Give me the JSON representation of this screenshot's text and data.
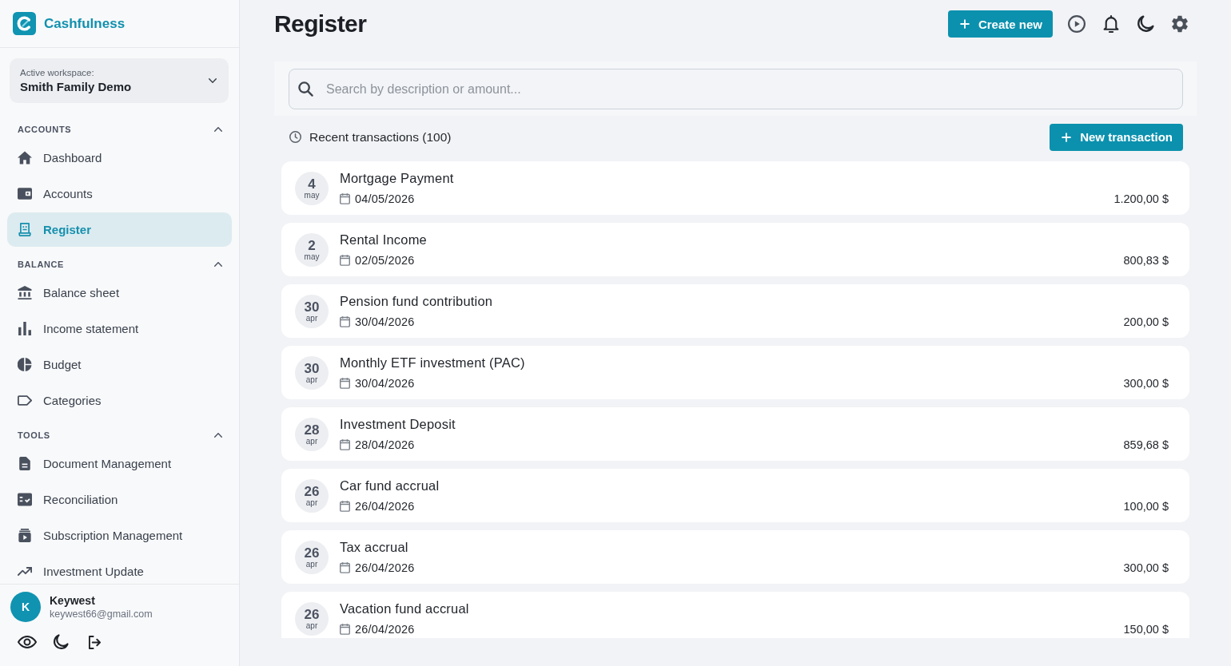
{
  "app": {
    "name": "Cashfulness"
  },
  "workspace": {
    "label": "Active workspace:",
    "value": "Smith Family Demo"
  },
  "sidebar": {
    "sections": [
      {
        "title": "ACCOUNTS",
        "expanded": true,
        "items": [
          {
            "label": "Dashboard",
            "selected": false
          },
          {
            "label": "Accounts",
            "selected": false
          },
          {
            "label": "Register",
            "selected": true
          }
        ]
      },
      {
        "title": "BALANCE",
        "expanded": true,
        "items": [
          {
            "label": "Balance sheet",
            "selected": false
          },
          {
            "label": "Income statement",
            "selected": false
          },
          {
            "label": "Budget",
            "selected": false
          },
          {
            "label": "Categories",
            "selected": false
          }
        ]
      },
      {
        "title": "TOOLS",
        "expanded": true,
        "items": [
          {
            "label": "Document Management",
            "selected": false
          },
          {
            "label": "Reconciliation",
            "selected": false
          },
          {
            "label": "Subscription Management",
            "selected": false
          },
          {
            "label": "Investment Update",
            "selected": false
          }
        ]
      }
    ]
  },
  "user": {
    "initial": "K",
    "name": "Keywest",
    "email": "keywest66@gmail.com"
  },
  "page": {
    "title": "Register",
    "create_button": "Create new"
  },
  "search": {
    "placeholder": "Search by description or amount..."
  },
  "recent": {
    "label": "Recent transactions (100)",
    "button": "New transaction"
  },
  "transactions": [
    {
      "day": "4",
      "month": "may",
      "title": "Mortgage Payment",
      "date": "04/05/2026",
      "amount": "1.200,00 $"
    },
    {
      "day": "2",
      "month": "may",
      "title": "Rental Income",
      "date": "02/05/2026",
      "amount": "800,83 $"
    },
    {
      "day": "30",
      "month": "apr",
      "title": "Pension fund contribution",
      "date": "30/04/2026",
      "amount": "200,00 $"
    },
    {
      "day": "30",
      "month": "apr",
      "title": "Monthly ETF investment (PAC)",
      "date": "30/04/2026",
      "amount": "300,00 $"
    },
    {
      "day": "28",
      "month": "apr",
      "title": "Investment Deposit",
      "date": "28/04/2026",
      "amount": "859,68 $"
    },
    {
      "day": "26",
      "month": "apr",
      "title": "Car fund accrual",
      "date": "26/04/2026",
      "amount": "100,00 $"
    },
    {
      "day": "26",
      "month": "apr",
      "title": "Tax accrual",
      "date": "26/04/2026",
      "amount": "300,00 $"
    },
    {
      "day": "26",
      "month": "apr",
      "title": "Vacation fund accrual",
      "date": "26/04/2026",
      "amount": "150,00 $"
    }
  ]
}
